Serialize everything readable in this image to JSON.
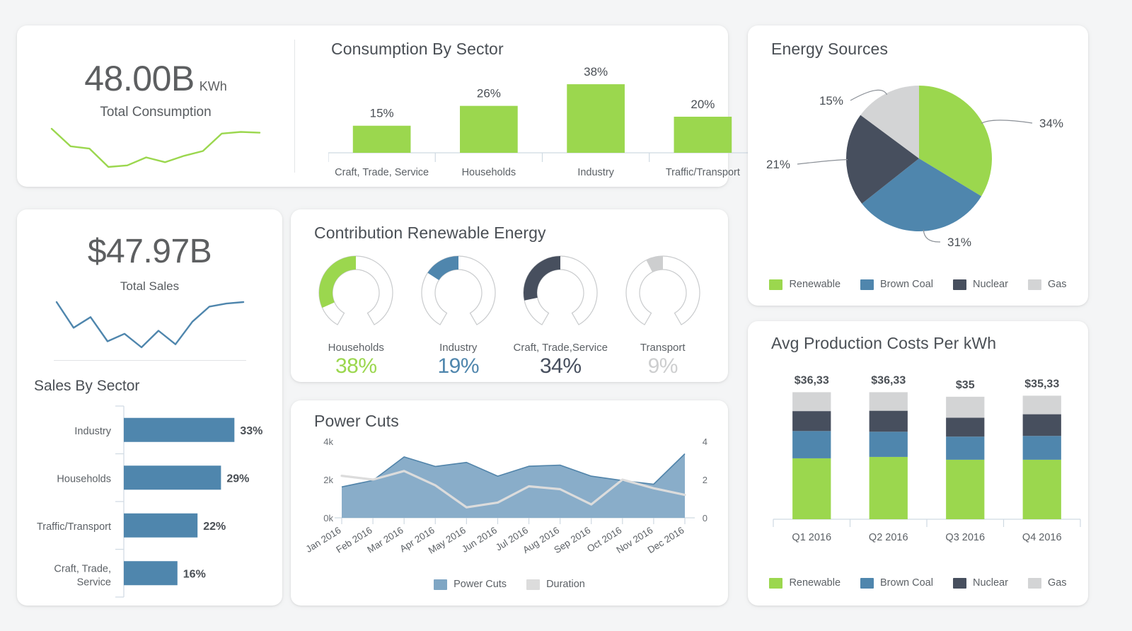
{
  "theme": {
    "green": "#9bd74e",
    "blue": "#4f86ad",
    "slate": "#474f5e",
    "gray": "#d3d4d5",
    "area_fill": "#7fa6c4",
    "area_stroke": "#5184aa",
    "duration_line": "#dcdcdc",
    "text": "#5c6166",
    "title": "#4a4f55",
    "value": "#5d5f61",
    "card_bg": "#ffffff",
    "page_bg": "#f4f5f6"
  },
  "consumption_kpi": {
    "value": "48.00B",
    "unit": "KWh",
    "label": "Total Consumption",
    "sparkline": [
      62,
      40,
      37,
      14,
      16,
      26,
      20,
      28,
      34,
      56,
      58,
      57
    ]
  },
  "sales_kpi": {
    "value": "$47.97B",
    "label": "Total Sales",
    "sparkline": [
      72,
      38,
      52,
      20,
      30,
      12,
      34,
      16,
      46,
      66,
      70,
      72
    ]
  },
  "sales_by_sector": {
    "title": "Sales By Sector",
    "categories": [
      "Industry",
      "Households",
      "Traffic/Transport",
      "Craft, Trade, Service"
    ],
    "values": [
      33,
      29,
      22,
      16
    ],
    "labels": [
      "33%",
      "29%",
      "22%",
      "16%"
    ]
  },
  "consumption_by_sector": {
    "title": "Consumption By Sector",
    "categories": [
      "Craft, Trade, Service",
      "Households",
      "Industry",
      "Traffic/Transport"
    ],
    "values": [
      15,
      26,
      38,
      20
    ],
    "labels": [
      "15%",
      "26%",
      "38%",
      "20%"
    ]
  },
  "renewable": {
    "title": "Contribution Renewable Energy",
    "gauges": [
      {
        "name": "Households",
        "value": 38,
        "label": "38%",
        "color": "#9bd74e"
      },
      {
        "name": "Industry",
        "value": 19,
        "label": "19%",
        "color": "#4f86ad"
      },
      {
        "name": "Craft, Trade,Service",
        "value": 34,
        "label": "34%",
        "color": "#474f5e"
      },
      {
        "name": "Transport",
        "value": 9,
        "label": "9%",
        "color": "#cdcecf"
      }
    ]
  },
  "power_cuts": {
    "title": "Power Cuts",
    "x": [
      "Jan 2016",
      "Feb 2016",
      "Mar 2016",
      "Apr 2016",
      "May 2016",
      "Jun 2016",
      "Jul 2016",
      "Aug 2016",
      "Sep 2016",
      "Oct 2016",
      "Nov 2016",
      "Dec 2016"
    ],
    "y_left_ticks": [
      "0k",
      "2k",
      "4k"
    ],
    "y_right_ticks": [
      "0",
      "2",
      "4"
    ],
    "series": [
      {
        "name": "Power Cuts",
        "type": "area",
        "color": "#7fa6c4",
        "values": [
          1620,
          1960,
          3190,
          2690,
          2900,
          2180,
          2700,
          2760,
          2180,
          1950,
          1760,
          3350
        ]
      },
      {
        "name": "Duration",
        "type": "line",
        "color": "#dcdcdc",
        "values": [
          2.2,
          2.0,
          2.45,
          1.7,
          0.55,
          0.8,
          1.65,
          1.5,
          0.7,
          2.0,
          1.55,
          1.2
        ]
      }
    ],
    "legend": [
      "Power Cuts",
      "Duration"
    ]
  },
  "energy_sources": {
    "title": "Energy Sources",
    "slices": [
      {
        "name": "Renewable",
        "value": 34,
        "label": "34%",
        "color": "#9bd74e"
      },
      {
        "name": "Brown Coal",
        "value": 31,
        "label": "31%",
        "color": "#4f86ad"
      },
      {
        "name": "Nuclear",
        "value": 21,
        "label": "21%",
        "color": "#474f5e"
      },
      {
        "name": "Gas",
        "value": 15,
        "label": "15%",
        "color": "#d3d4d5"
      }
    ],
    "legend": [
      "Renewable",
      "Brown Coal",
      "Nuclear",
      "Gas"
    ]
  },
  "production_costs": {
    "title": "Avg Production Costs Per kWh",
    "categories": [
      "Q1 2016",
      "Q2 2016",
      "Q3 2016",
      "Q4 2016"
    ],
    "totals": [
      "$36,33",
      "$36,33",
      "$35",
      "$35,33"
    ],
    "series": [
      {
        "name": "Renewable",
        "color": "#9bd74e",
        "values": [
          17.4,
          17.8,
          17.0,
          17.0
        ]
      },
      {
        "name": "Brown Coal",
        "color": "#4f86ad",
        "values": [
          7.8,
          7.2,
          6.6,
          6.8
        ]
      },
      {
        "name": "Nuclear",
        "color": "#474f5e",
        "values": [
          5.7,
          6.0,
          5.4,
          6.2
        ]
      },
      {
        "name": "Gas",
        "color": "#d3d4d5",
        "values": [
          5.4,
          5.3,
          6.0,
          5.3
        ]
      }
    ],
    "legend": [
      "Renewable",
      "Brown Coal",
      "Nuclear",
      "Gas"
    ]
  }
}
